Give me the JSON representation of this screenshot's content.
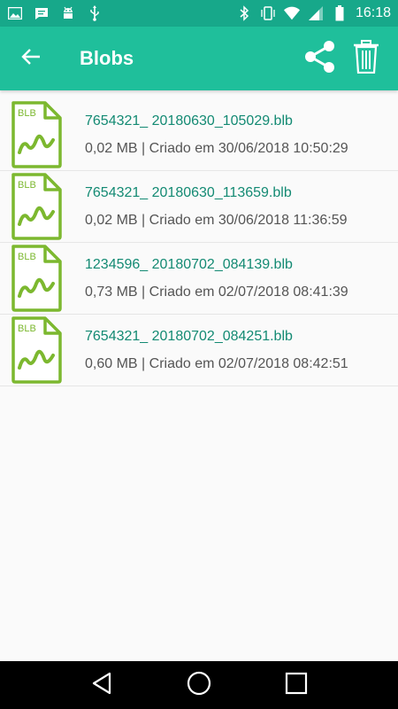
{
  "status_bar": {
    "time": "16:18",
    "left_icons": [
      "image-icon",
      "message-icon",
      "android-icon",
      "usb-icon"
    ],
    "right_icons": [
      "bluetooth-icon",
      "vibrate-icon",
      "wifi-icon",
      "signal-icon",
      "battery-icon"
    ]
  },
  "app_bar": {
    "title": "Blobs",
    "back_icon": "arrow-left-icon",
    "share_icon": "share-icon",
    "delete_icon": "trash-icon"
  },
  "files": [
    {
      "icon_label": "BLB",
      "name": "7654321_ 20180630_105029.blb",
      "meta": "0,02 MB | Criado em 30/06/2018 10:50:29"
    },
    {
      "icon_label": "BLB",
      "name": "7654321_ 20180630_113659.blb",
      "meta": "0,02 MB | Criado em 30/06/2018 11:36:59"
    },
    {
      "icon_label": "BLB",
      "name": "1234596_ 20180702_084139.blb",
      "meta": "0,73 MB | Criado em 02/07/2018 08:41:39"
    },
    {
      "icon_label": "BLB",
      "name": "7654321_ 20180702_084251.blb",
      "meta": "0,60 MB | Criado em 02/07/2018 08:42:51"
    }
  ],
  "colors": {
    "status_bar": "#17a88a",
    "app_bar": "#1fbf9b",
    "file_name": "#138a73",
    "icon_green": "#7cb82f",
    "background": "#fafafa"
  }
}
